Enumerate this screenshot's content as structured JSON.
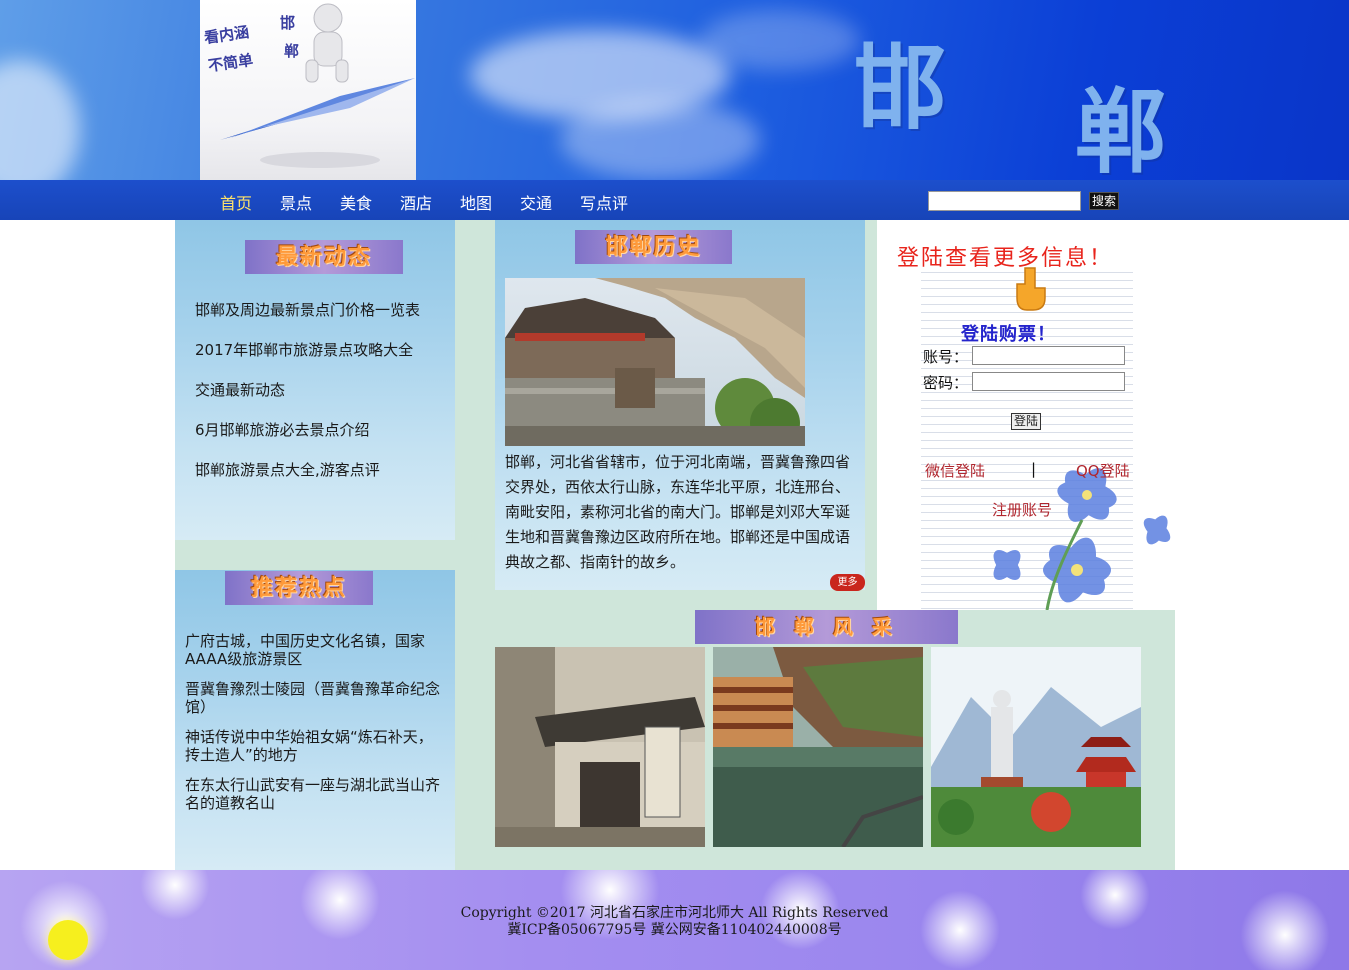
{
  "banner": {
    "logo_line_1": "看内涵",
    "logo_line_2": "不简单",
    "logo_side_1": "邯",
    "logo_side_2": "郸",
    "title_char_1": "邯",
    "title_char_2": "郸"
  },
  "nav": {
    "items": [
      "首页",
      "景点",
      "美食",
      "酒店",
      "地图",
      "交通",
      "写点评"
    ],
    "active": "首页",
    "search_placeholder": "",
    "search_button": "搜索"
  },
  "news": {
    "heading": "最新动态",
    "links": [
      "邯郸及周边最新景点门价格一览表",
      "2017年邯郸市旅游景点攻略大全",
      "交通最新动态",
      "6月邯郸旅游必去景点介绍",
      "邯郸旅游景点大全,游客点评"
    ]
  },
  "recommend": {
    "heading": "推荐热点",
    "items": [
      "广府古城，中国历史文化名镇，国家AAAA级旅游景区",
      "晋冀鲁豫烈士陵园（晋冀鲁豫革命纪念馆）",
      "神话传说中中华始祖女娲“炼石补天，抟土造人”的地方",
      "在东太行山武安有一座与湖北武当山齐名的道教名山"
    ]
  },
  "history": {
    "heading": "邯郸历史",
    "text": "邯郸，河北省省辖市，位于河北南端，晋冀鲁豫四省交界处，西依太行山脉，东连华北平原，北连邢台、南毗安阳，素称河北省的南大门。邯郸是刘邓大军诞生地和晋冀鲁豫边区政府所在地。邯郸还是中国成语典故之都、指南针的故乡。",
    "more_label": "更多"
  },
  "login": {
    "title": "登陆查看更多信息！",
    "buy_title": "登陆购票！",
    "account_label": "账号：",
    "password_label": "密码：",
    "account_value": "",
    "password_value": "",
    "submit_label": "登陆",
    "wechat_label": "微信登陆",
    "separator": "|",
    "qq_label": "QQ登陆",
    "register_label": "注册账号"
  },
  "gallery": {
    "heading": "邯 郸 风 采"
  },
  "footer": {
    "line_1": "Copyright ©2017   河北省石家庄市河北师大   All   Rights   Reserved",
    "line_2": "冀ICP备05067795号   冀公网安备110402440008号"
  },
  "colors": {
    "nav_bg": "#1a49c4",
    "nav_active": "#ffe36a",
    "login_title": "#e8241c",
    "buy_title": "#2424cc",
    "badge_text": "#ff9a3a",
    "link_red": "#b0262e"
  }
}
